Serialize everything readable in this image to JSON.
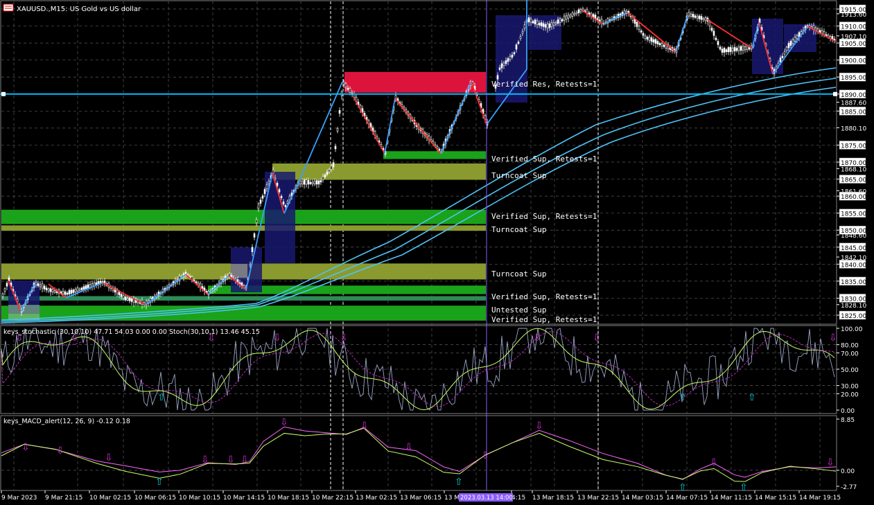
{
  "header": {
    "symbol_label": "XAUUSD.,M15: US Gold vs US dollar"
  },
  "colors": {
    "background": "#000000",
    "grid": "#5a5a5a",
    "resistance_zone": "#dc143c",
    "verified_support": "#1aa31a",
    "turncoat_support": "#8a9a2e",
    "untested_support": "#2e8b57",
    "box_blue": "#191970",
    "ma_line": "#4fc3f7",
    "zigzag_up": "#3aa0ff",
    "zigzag_down": "#ff3030",
    "stoch_arrow_down": "#d030d0",
    "stoch_arrow_up": "#00ced1",
    "selected_line": "#00bfff"
  },
  "price_axis": {
    "labels": [
      "1915.00",
      "1913.60",
      "1910.00",
      "1907.10",
      "1905.00",
      "1900.00",
      "1895.00",
      "1890.00",
      "1887.60",
      "1885.00",
      "1880.10",
      "1875.00",
      "1870.00",
      "1868.10",
      "1865.00",
      "1861.60",
      "1860.00",
      "1855.00",
      "1850.00",
      "1848.60",
      "1845.00",
      "1842.10",
      "1840.00",
      "1835.00",
      "1830.00",
      "1828.10",
      "1825.00"
    ],
    "current_price": "1905.00",
    "line_price": "1890.00",
    "range": [
      1823,
      1917
    ]
  },
  "zones": [
    {
      "label": "Verified Res, Retests=1",
      "kind": "resistance",
      "low": 1890.4,
      "high": 1896.5
    },
    {
      "label": "Verified Sup, Retests=1",
      "kind": "verified",
      "low": 1870.9,
      "high": 1873.2
    },
    {
      "label": "Turncoat Sup",
      "kind": "turncoat",
      "low": 1864.8,
      "high": 1869.6
    },
    {
      "label": "Verified Sup, Retests=1",
      "kind": "verified",
      "low": 1851.8,
      "high": 1856.0
    },
    {
      "label": "Turncoat Sup",
      "kind": "turncoat",
      "low": 1849.8,
      "high": 1851.4
    },
    {
      "label": "Turncoat Sup",
      "kind": "turncoat",
      "low": 1835.5,
      "high": 1840.2
    },
    {
      "label": "Untested Sup",
      "kind": "untested",
      "low": 1829.3,
      "high": 1830.6
    },
    {
      "label": "Verified Sup, Retests=1",
      "kind": "verified",
      "low": 1831.2,
      "high": 1833.7
    },
    {
      "label": "Verified Sup, Retests=1",
      "kind": "verified",
      "low": 1823.4,
      "high": 1827.8
    }
  ],
  "stochastic": {
    "label": "keys_stochastic (30,10,10) 47.71 54.03 0.00 0.00 Stoch(30,10,1) 13.46 45.15",
    "levels": [
      "100.00",
      "80.00",
      "70.00",
      "50.00",
      "30.00",
      "20.00",
      "0.00"
    ]
  },
  "macd": {
    "label": "keys_MACD_alert(12, 26, 9) -0.12 0.18",
    "levels": [
      "8.85",
      "0.00",
      "-2.77"
    ]
  },
  "time_axis": {
    "labels": [
      "9 Mar 2023",
      "9 Mar 21:15",
      "10 Mar 02:15",
      "10 Mar 06:15",
      "10 Mar 10:15",
      "10 Mar 14:15",
      "10 Mar 18:15",
      "10 Mar 22:15",
      "13 Mar 02:15",
      "13 Mar 06:15",
      "13 M",
      "4:15",
      "13 Mar 18:15",
      "13 Mar 22:15",
      "14 Mar 03:15",
      "14 Mar 07:15",
      "14 Mar 11:15",
      "14 Mar 15:15",
      "14 Mar 19:15"
    ],
    "crosshair_time": "2023.03.13 14:00"
  }
}
